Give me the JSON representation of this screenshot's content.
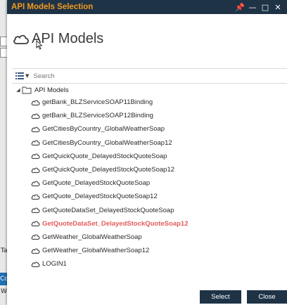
{
  "window": {
    "title": "API Models Selection",
    "buttons": [
      {
        "name": "pin-icon",
        "glyph": "📌"
      },
      {
        "name": "minimize-icon",
        "glyph": "—"
      },
      {
        "name": "maximize-icon",
        "glyph": "□"
      },
      {
        "name": "close-icon",
        "glyph": "✕"
      }
    ]
  },
  "header": {
    "title": "API Models",
    "icon": "cloud-icon"
  },
  "search": {
    "placeholder": "Search",
    "value": ""
  },
  "tree": {
    "root_label": "API Models",
    "items": [
      {
        "label": "getBank_BLZServiceSOAP11Binding"
      },
      {
        "label": "getBank_BLZServiceSOAP12Binding"
      },
      {
        "label": "GetCitiesByCountry_GlobalWeatherSoap"
      },
      {
        "label": "GetCitiesByCountry_GlobalWeatherSoap12"
      },
      {
        "label": "GetQuickQuote_DelayedStockQuoteSoap"
      },
      {
        "label": "GetQuickQuote_DelayedStockQuoteSoap12"
      },
      {
        "label": "GetQuote_DelayedStockQuoteSoap"
      },
      {
        "label": "GetQuote_DelayedStockQuoteSoap12"
      },
      {
        "label": "GetQuoteDataSet_DelayedStockQuoteSoap"
      },
      {
        "label": "GetQuoteDataSet_DelayedStockQuoteSoap12",
        "selected": true
      },
      {
        "label": "GetWeather_GlobalWeatherSoap"
      },
      {
        "label": "GetWeather_GlobalWeatherSoap12"
      },
      {
        "label": "LOGIN1"
      }
    ]
  },
  "footer": {
    "select_label": "Select",
    "close_label": "Close"
  },
  "background_app": {
    "tab_text": "Ta",
    "blue_text": "Co",
    "bottom_text": "We"
  },
  "colors": {
    "titlebar": "#1f3347",
    "title_text": "#f39a1e",
    "selected_item": "#e35b5b"
  }
}
